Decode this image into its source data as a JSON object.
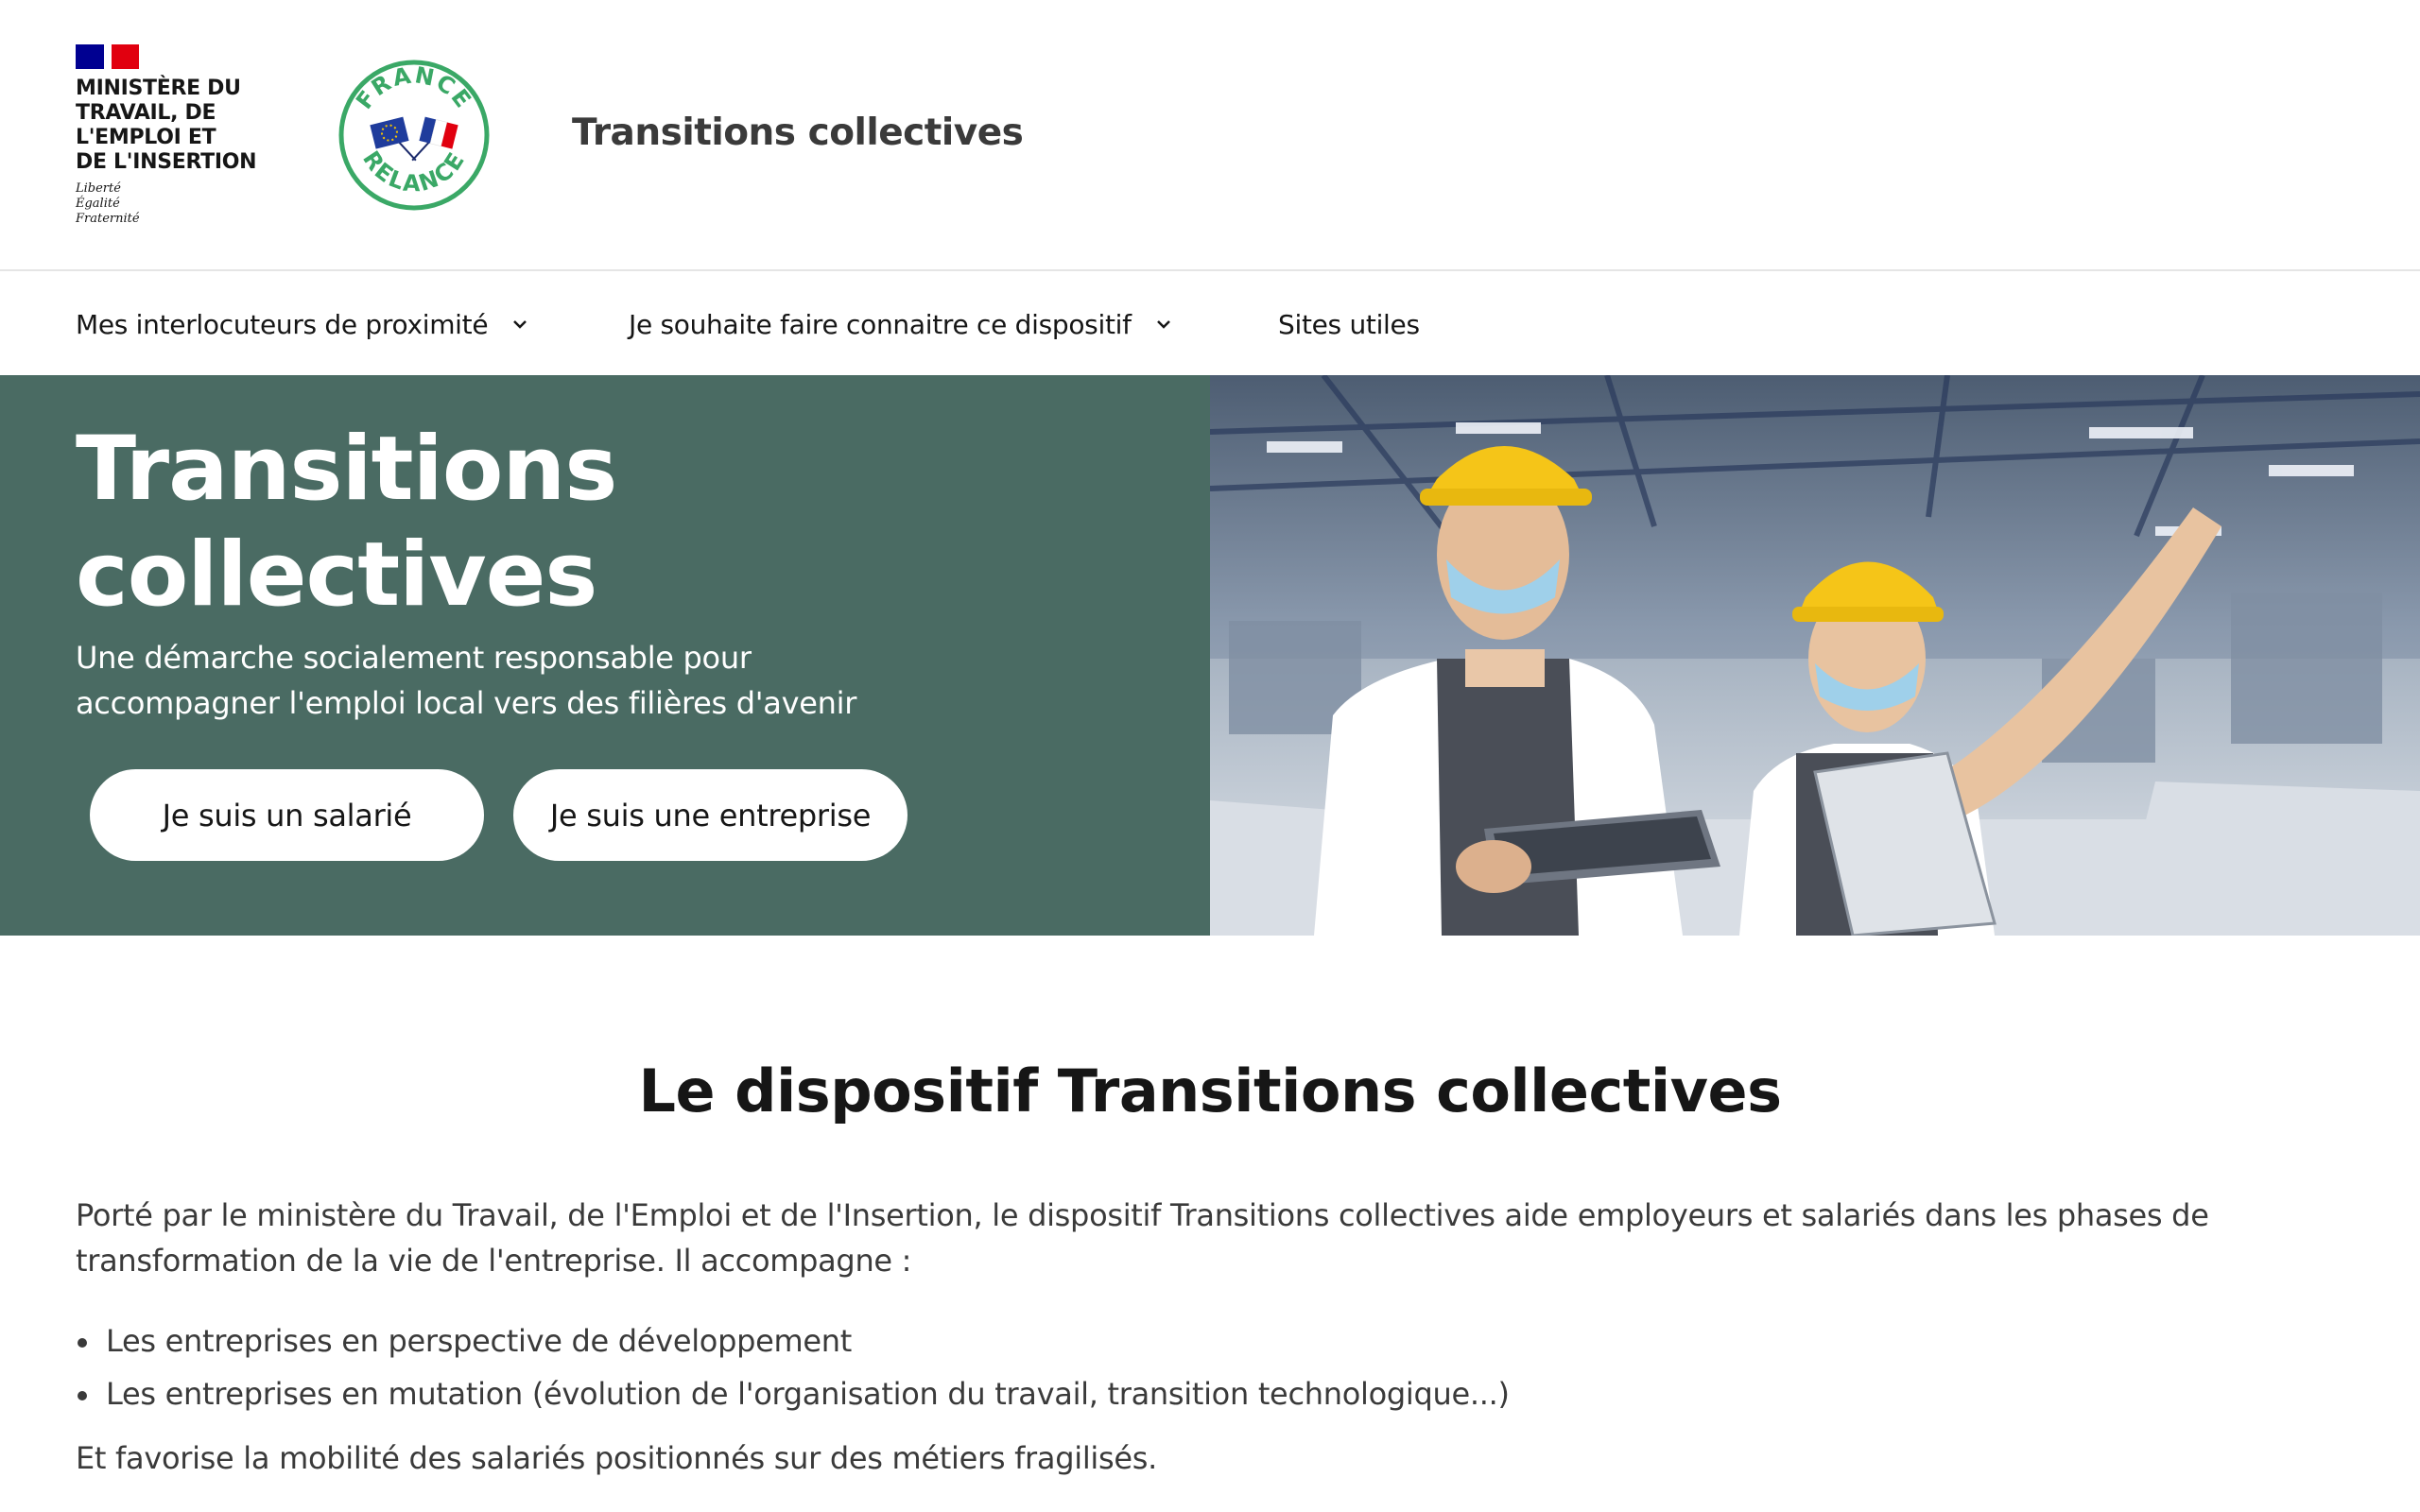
{
  "header": {
    "ministry_name": "MINISTÈRE DU\nTRAVAIL, DE\nL'EMPLOI ET\nDE L'INSERTION",
    "motto": "Liberté\nÉgalité\nFraternité",
    "relance_logo_text": "FRANCE RELANCE",
    "site_title": "Transitions collectives"
  },
  "nav": {
    "items": [
      {
        "label": "Mes interlocuteurs de proximité",
        "has_dropdown": true
      },
      {
        "label": "Je souhaite faire connaitre ce dispositif",
        "has_dropdown": true
      },
      {
        "label": "Sites utiles",
        "has_dropdown": false
      }
    ]
  },
  "hero": {
    "title": "Transitions collectives",
    "subtitle": "Une démarche socialement responsable pour accompagner l'emploi local vers des filières d'avenir",
    "button_salarie": "Je suis un salarié",
    "button_entreprise": "Je suis une entreprise",
    "background_color": "#4a6b63"
  },
  "content": {
    "section_title": "Le dispositif Transitions collectives",
    "intro": "Porté par le ministère du Travail, de l'Emploi et de l'Insertion, le dispositif Transitions collectives aide employeurs et salariés dans les phases de transformation de la vie de l'entreprise. Il accompagne :",
    "bullets": [
      "Les entreprises en perspective de développement",
      "Les entreprises en mutation (évolution de l'organisation du travail, transition technologique...)"
    ],
    "outro": "Et favorise la mobilité des salariés positionnés sur des métiers fragilisés."
  },
  "colors": {
    "hero_green": "#4a6b63",
    "relance_green": "#3aa866",
    "flag_blue": "#000091",
    "flag_red": "#e1000f"
  }
}
